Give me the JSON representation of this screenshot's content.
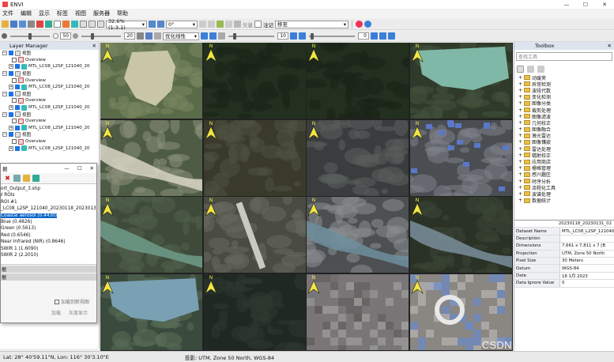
{
  "window": {
    "title": "ENVI"
  },
  "menu": [
    "文件",
    "编辑",
    "显示",
    "标签",
    "视图",
    "服务器",
    "帮助"
  ],
  "toolbar1": {
    "zoom": "32.6% (1:3.1)",
    "rotation": "0°",
    "vector_label": "矢量",
    "annotation_label": "注记",
    "goto": "移至"
  },
  "toolbar2": {
    "brightness": "50",
    "contrast": "20",
    "stretch": "优化线性",
    "sharpen": "10",
    "transparency": "0"
  },
  "layer_manager": {
    "title": "Layer Manager",
    "items": [
      {
        "type": "view",
        "label": "视图"
      },
      {
        "type": "overview",
        "label": "Overview"
      },
      {
        "type": "layer",
        "label": "MTL_LC08_L2SP_121040_20"
      },
      {
        "type": "view",
        "label": "视图"
      },
      {
        "type": "overview",
        "label": "Overview"
      },
      {
        "type": "layer",
        "label": "MTL_LC08_L2SP_121040_20"
      },
      {
        "type": "view",
        "label": "视图"
      },
      {
        "type": "overview",
        "label": "Overview"
      },
      {
        "type": "layer",
        "label": "MTL_LC08_L2SP_121040_20"
      },
      {
        "type": "view",
        "label": "视图"
      },
      {
        "type": "overview",
        "label": "Overview"
      },
      {
        "type": "layer",
        "label": "MTL_LC08_L2SP_121040_20"
      },
      {
        "type": "view",
        "label": "视图"
      },
      {
        "type": "overview",
        "label": "Overview"
      },
      {
        "type": "layer",
        "label": "MTL_LC08_L2SP_121040_20"
      }
    ]
  },
  "data_dialog": {
    "title": "据",
    "tree": [
      "ort_Output_3.shp",
      "ℓ ROIs",
      "ROI #1",
      "_LC08_L2SP_121040_20230118_20230131_02_",
      "Coastal aerosol (0.4430)",
      "Blue (0.4826)",
      "Green (0.5613)",
      "Red (0.6546)",
      "Near Infrared (NIR) (0.8646)",
      "SWIR 1 (1.6090)",
      "SWIR 2 (2.2010)"
    ],
    "selected_index": 4,
    "bars": [
      "据",
      "据"
    ],
    "checkbox_label": "加载到新视图",
    "load_button": "加载",
    "gray_button": "灰度显示"
  },
  "toolbox": {
    "title": "Toolbox",
    "search_placeholder": "查找工具",
    "items": [
      "动缓夹",
      "异常检测",
      "波段代数",
      "变化检测",
      "图像分类",
      "裁剪处理",
      "图像滤波",
      "几何校正",
      "图像融合",
      "激光雷达",
      "图像镶嵌",
      "雷达处理",
      "辐射校正",
      "应用商店",
      "栅格管理",
      "感兴趣区",
      "时序分析",
      "流程化工具",
      "波谱处理",
      "数据统计"
    ]
  },
  "metadata": {
    "header_value": "20230118_20230131_02",
    "rows": [
      {
        "key": "Dataset Name",
        "value": "MTL_LC08_L2SP_121040_20"
      },
      {
        "key": "Description",
        "value": ""
      },
      {
        "key": "Dimensions",
        "value": "7,661 x 7,811 x 7 [B"
      },
      {
        "key": "Projection",
        "value": "UTM, Zone 50 North"
      },
      {
        "key": "Pixel Size",
        "value": "30 Meters"
      },
      {
        "key": "Datum",
        "value": "WGS-84"
      },
      {
        "key": "Date",
        "value": "18 1月 2023"
      },
      {
        "key": "Data Ignore Value",
        "value": "0"
      }
    ]
  },
  "status": {
    "coords": "Lat: 28° 40'59.11\"N, Lon: 116° 30'3.10\"E",
    "projection": "投影: UTM, Zone 50 North, WGS-84"
  },
  "watermark": "CSDN @Promising_GEO",
  "colors": {
    "selection": "#0a64c8",
    "active_view_border": "#3ec9c9",
    "north_arrow": "#f2e640"
  },
  "tiles": [
    {
      "theme": "lake-light"
    },
    {
      "theme": "dark-hills"
    },
    {
      "theme": "dark-hills"
    },
    {
      "theme": "teal-lake"
    },
    {
      "theme": "river-light"
    },
    {
      "theme": "fields"
    },
    {
      "theme": "urban"
    },
    {
      "theme": "urban-blue"
    },
    {
      "theme": "river-green"
    },
    {
      "theme": "airport"
    },
    {
      "theme": "urban-bridge"
    },
    {
      "theme": "dark-river"
    },
    {
      "theme": "lake-blur"
    },
    {
      "theme": "dark-blur"
    },
    {
      "theme": "pixel-blur"
    },
    {
      "theme": "pixel-circle"
    }
  ]
}
